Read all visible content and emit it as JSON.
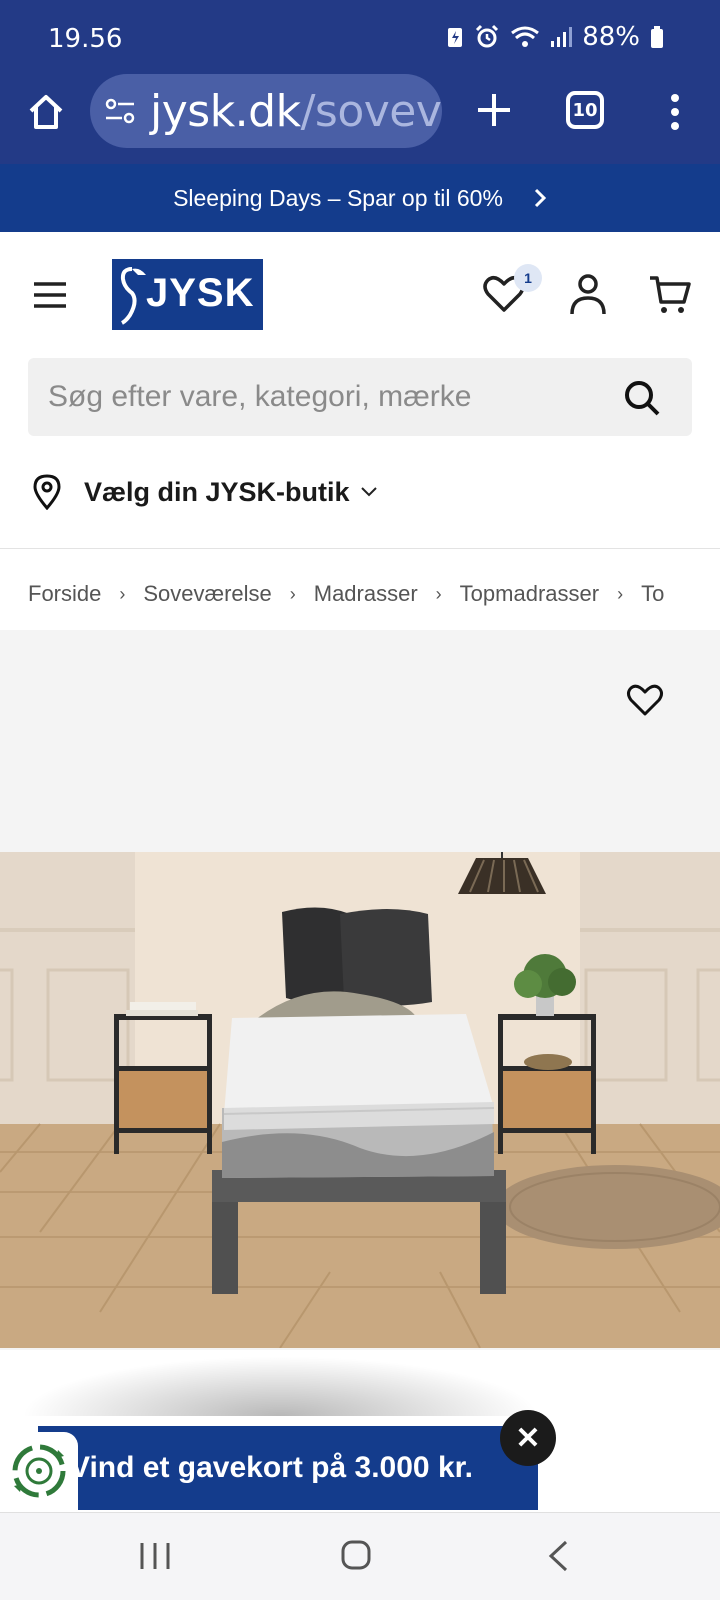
{
  "status_bar": {
    "time": "19.56",
    "battery": "88%"
  },
  "browser": {
    "url_domain": "jysk.dk",
    "url_path": "/sovev",
    "tab_count": "10"
  },
  "promo": {
    "text": "Sleeping Days – Spar op til 60%"
  },
  "header": {
    "logo_text": "JYSK",
    "wishlist_count": "1"
  },
  "search": {
    "placeholder": "Søg efter vare, kategori, mærke"
  },
  "store_selector": {
    "label": "Vælg din JYSK-butik"
  },
  "breadcrumb": [
    "Forside",
    "Soveværelse",
    "Madrasser",
    "Topmadrasser",
    "To"
  ],
  "popup": {
    "text": "Vind et gavekort på 3.000 kr.",
    "close": "✕"
  },
  "colors": {
    "browser_chrome": "#233a86",
    "brand_blue": "#143c8c",
    "search_bg": "#f0f0f0",
    "product_bg": "#f4f4f4"
  },
  "icons": [
    "home-icon",
    "site-settings-icon",
    "plus-icon",
    "tabs-icon",
    "overflow-menu-icon",
    "hamburger-icon",
    "heart-icon",
    "user-icon",
    "cart-icon",
    "search-icon",
    "location-pin-icon",
    "chevron-down-icon",
    "chevron-right-icon",
    "close-icon",
    "recents-icon",
    "back-icon"
  ]
}
